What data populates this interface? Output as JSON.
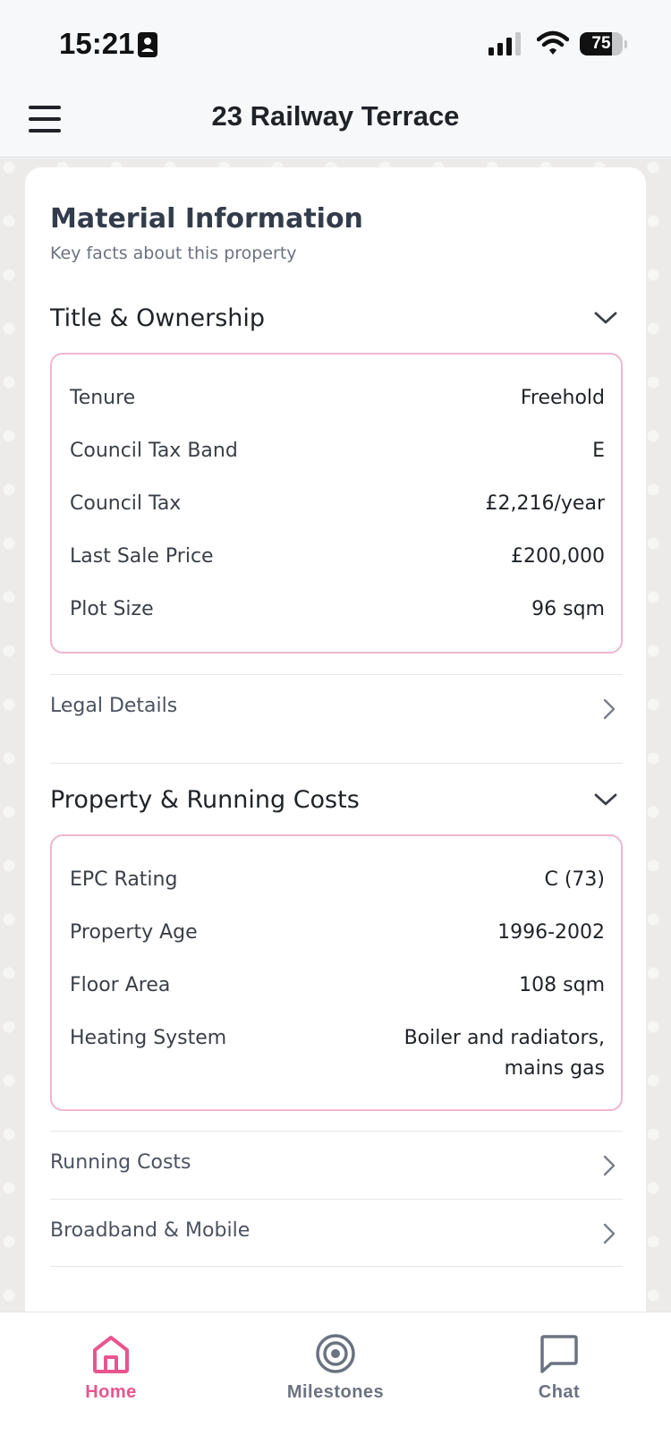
{
  "status_bar": {
    "time": "15:21",
    "battery_level": "75",
    "battery_fraction": 0.75
  },
  "header": {
    "title": "23 Railway Terrace"
  },
  "material_info": {
    "heading": "Material Information",
    "subheading": "Key facts about this property"
  },
  "title_ownership": {
    "title": "Title & Ownership",
    "rows": [
      {
        "label": "Tenure",
        "value": "Freehold"
      },
      {
        "label": "Council Tax Band",
        "value": "E"
      },
      {
        "label": "Council Tax",
        "value": "£2,216/year"
      },
      {
        "label": "Last Sale Price",
        "value": "£200,000"
      },
      {
        "label": "Plot Size",
        "value": "96 sqm"
      }
    ],
    "link": "Legal Details"
  },
  "property_costs": {
    "title": "Property & Running Costs",
    "rows": [
      {
        "label": "EPC Rating",
        "value": "C (73)"
      },
      {
        "label": "Property Age",
        "value": "1996-2002"
      },
      {
        "label": "Floor Area",
        "value": "108 sqm"
      },
      {
        "label": "Heating System",
        "value_line1": "Boiler and radiators,",
        "value_line2": "mains gas"
      }
    ],
    "links": [
      "Running Costs",
      "Broadband & Mobile"
    ]
  },
  "bottom_nav": {
    "items": [
      {
        "label": "Home",
        "icon": "home-icon",
        "active": true
      },
      {
        "label": "Milestones",
        "icon": "target-icon",
        "active": false
      },
      {
        "label": "Chat",
        "icon": "chat-icon",
        "active": false
      }
    ]
  },
  "colors": {
    "accent": "#e8558f",
    "border_pink": "#efb6cf",
    "inactive": "#6b7280"
  }
}
